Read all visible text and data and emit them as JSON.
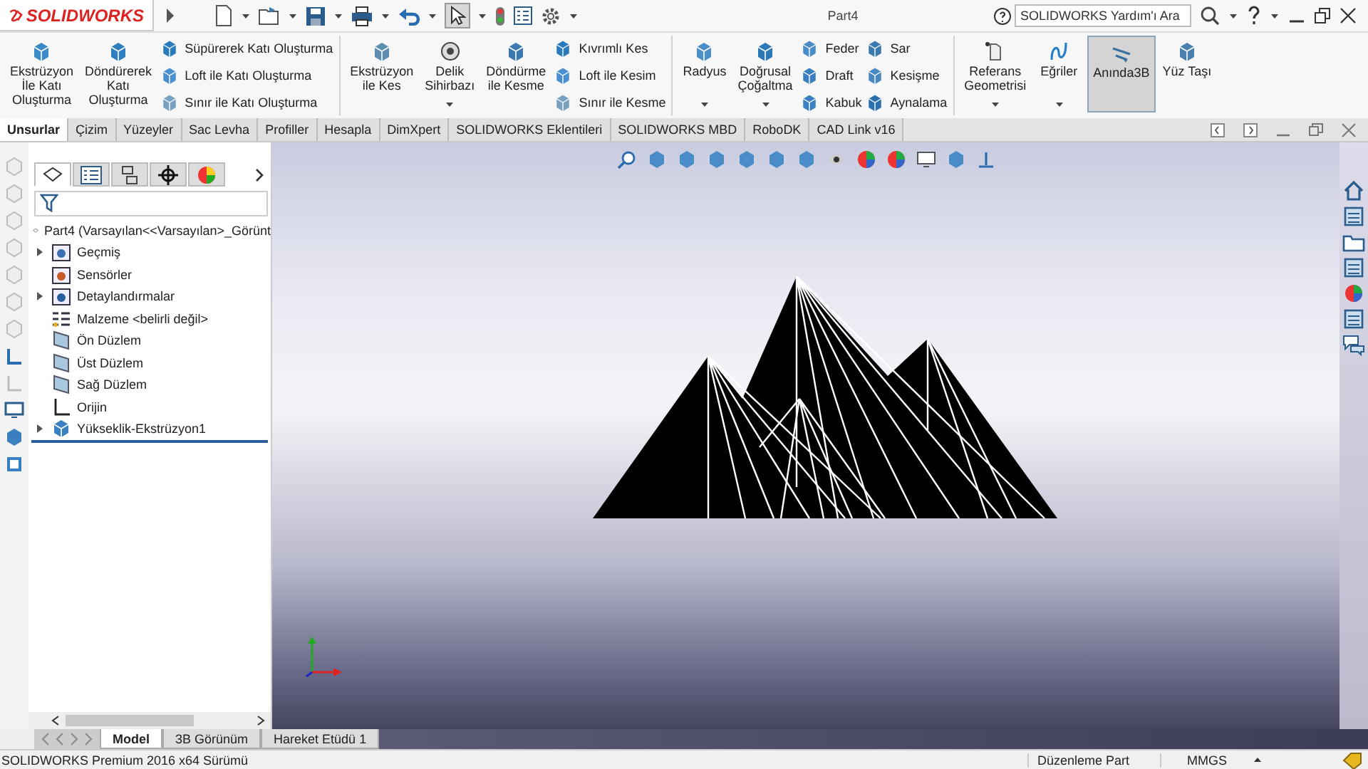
{
  "title_bar": {
    "app_name": "SOLIDWORKS",
    "document_title": "Part4",
    "search_placeholder": "SOLIDWORKS Yardım'ı Ara"
  },
  "ribbon": {
    "groups": [
      {
        "items": [
          {
            "kind": "large",
            "label": "Ekstrüzyon\nİle Katı\nOluşturma",
            "has_menu": false,
            "selected": false
          },
          {
            "kind": "large",
            "label": "Döndürerek\nKatı\nOluşturma",
            "has_menu": false,
            "selected": false
          },
          {
            "kind": "stack",
            "entries": [
              "Süpürerek Katı Oluşturma",
              "Loft ile Katı Oluşturma",
              "Sınır ile Katı Oluşturma"
            ]
          }
        ]
      },
      {
        "items": [
          {
            "kind": "large",
            "label": "Ekstrüzyon\nile Kes",
            "has_menu": false,
            "selected": false
          },
          {
            "kind": "large",
            "label": "Delik\nSihirbazı",
            "has_menu": true,
            "selected": false
          },
          {
            "kind": "large",
            "label": "Döndürme\nile Kesme",
            "has_menu": false,
            "selected": false
          },
          {
            "kind": "stack",
            "entries": [
              "Kıvrımlı Kes",
              "Loft ile Kesim",
              "Sınır ile Kesme"
            ]
          }
        ]
      },
      {
        "items": [
          {
            "kind": "large",
            "label": "Radyus",
            "has_menu": true,
            "selected": false
          },
          {
            "kind": "large",
            "label": "Doğrusal\nÇoğaltma",
            "has_menu": true,
            "selected": false
          },
          {
            "kind": "stack",
            "entries": [
              "Feder",
              "Draft",
              "Kabuk"
            ]
          },
          {
            "kind": "stack",
            "entries": [
              "Sar",
              "Kesişme",
              "Aynalama"
            ]
          }
        ]
      },
      {
        "items": [
          {
            "kind": "large",
            "label": "Referans\nGeometrisi",
            "has_menu": true,
            "selected": false
          },
          {
            "kind": "large",
            "label": "Eğriler",
            "has_menu": true,
            "selected": false
          },
          {
            "kind": "large",
            "label": "Anında3B",
            "has_menu": false,
            "selected": true
          },
          {
            "kind": "large",
            "label": "Yüz Taşı",
            "has_menu": false,
            "selected": false
          }
        ]
      }
    ]
  },
  "tabs": [
    {
      "label": "Unsurlar",
      "selected": true
    },
    {
      "label": "Çizim",
      "selected": false
    },
    {
      "label": "Yüzeyler",
      "selected": false
    },
    {
      "label": "Sac Levha",
      "selected": false
    },
    {
      "label": "Profiller",
      "selected": false
    },
    {
      "label": "Hesapla",
      "selected": false
    },
    {
      "label": "DimXpert",
      "selected": false
    },
    {
      "label": "SOLIDWORKS Eklentileri",
      "selected": false
    },
    {
      "label": "SOLIDWORKS MBD",
      "selected": false
    },
    {
      "label": "RoboDK",
      "selected": false
    },
    {
      "label": "CAD Link v16",
      "selected": false
    }
  ],
  "feature_manager": {
    "panel_tabs": [
      {
        "selected": true
      },
      {
        "selected": false
      },
      {
        "selected": false
      },
      {
        "selected": false
      },
      {
        "selected": false
      }
    ],
    "root": "Part4  (Varsayılan<<Varsayılan>_Görünt",
    "items": [
      {
        "label": "Geçmiş",
        "kind": "folder",
        "expandable": true
      },
      {
        "label": "Sensörler",
        "kind": "folder",
        "expandable": false
      },
      {
        "label": "Detaylandırmalar",
        "kind": "folder",
        "expandable": true
      },
      {
        "label": "Malzeme <belirli değil>",
        "kind": "material",
        "expandable": false
      },
      {
        "label": "Ön Düzlem",
        "kind": "plane",
        "expandable": false
      },
      {
        "label": "Üst Düzlem",
        "kind": "plane",
        "expandable": false
      },
      {
        "label": "Sağ Düzlem",
        "kind": "plane",
        "expandable": false
      },
      {
        "label": "Orijin",
        "kind": "origin",
        "expandable": false
      },
      {
        "label": "Yükseklik-Ekstrüzyon1",
        "kind": "feature",
        "expandable": true
      }
    ]
  },
  "bottom_tabs": [
    {
      "label": "Model",
      "selected": true
    },
    {
      "label": "3B Görünüm",
      "selected": false
    },
    {
      "label": "Hareket Etüdü 1",
      "selected": false
    }
  ],
  "status_bar": {
    "product": "SOLIDWORKS Premium 2016 x64 Sürümü",
    "mode": "Düzenleme Part",
    "units": "MMGS"
  }
}
